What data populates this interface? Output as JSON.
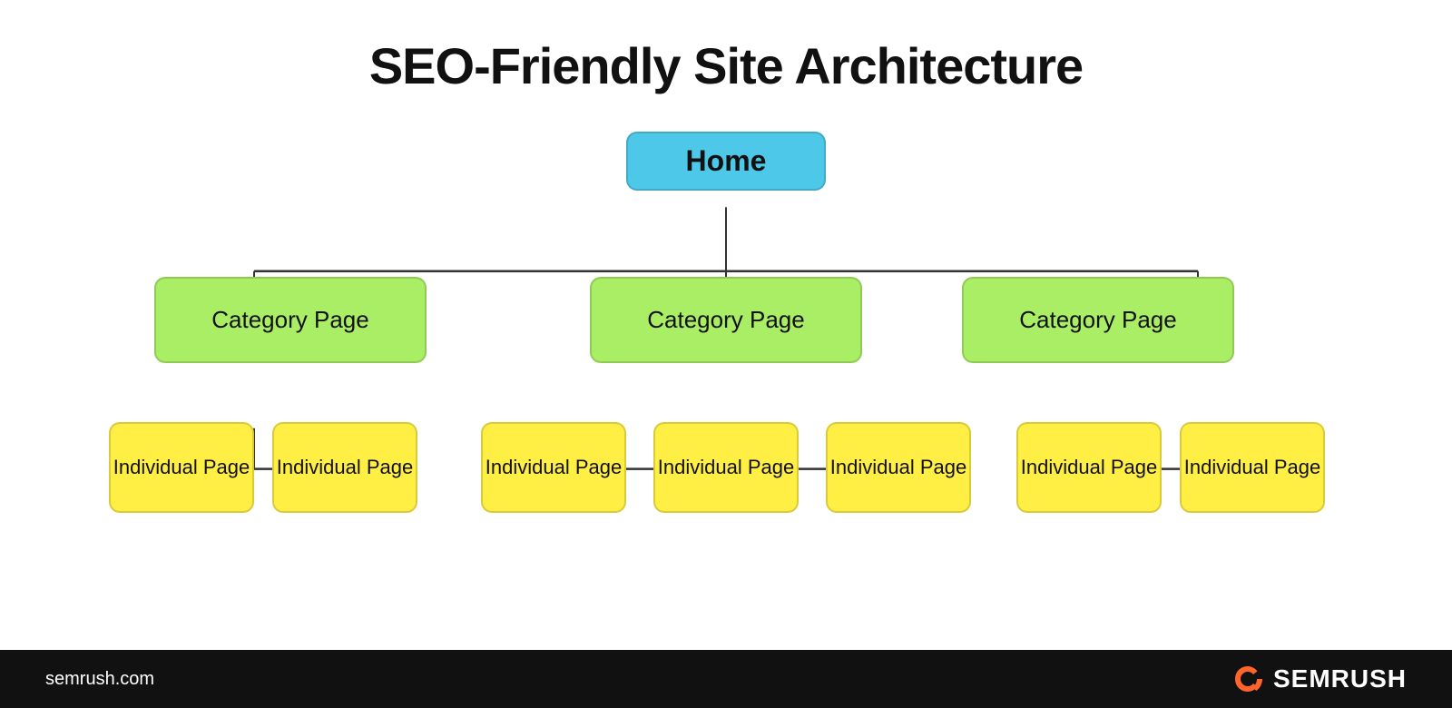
{
  "title": "SEO-Friendly Site Architecture",
  "nodes": {
    "home": {
      "label": "Home"
    },
    "category": {
      "label": "Category Page"
    },
    "individual": {
      "label": "Individual Page"
    }
  },
  "footer": {
    "domain": "semrush.com",
    "brand": "SEMRUSH"
  }
}
